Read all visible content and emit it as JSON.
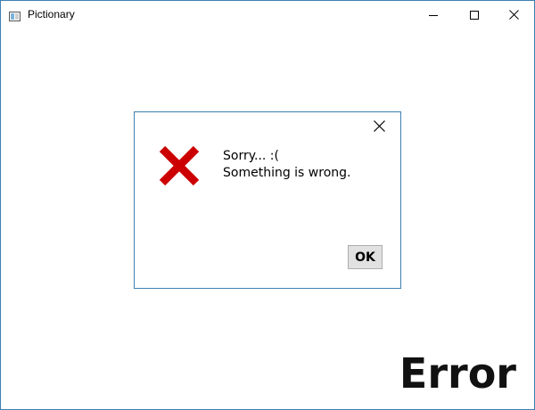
{
  "window": {
    "title": "Pictionary",
    "app_icon": "window-app-icon",
    "controls": {
      "minimize_icon": "minimize-icon",
      "maximize_icon": "maximize-icon",
      "close_icon": "close-icon"
    }
  },
  "dialog": {
    "close_icon": "close-icon",
    "error_icon": "error-x-icon",
    "error_icon_color": "#cc0000",
    "message_line1": "Sorry... :(",
    "message_line2": "Something is wrong.",
    "ok_label": "OK"
  },
  "content": {
    "label": "Error"
  },
  "colors": {
    "window_border": "#3c7fb1",
    "button_face": "#e1e1e1"
  }
}
